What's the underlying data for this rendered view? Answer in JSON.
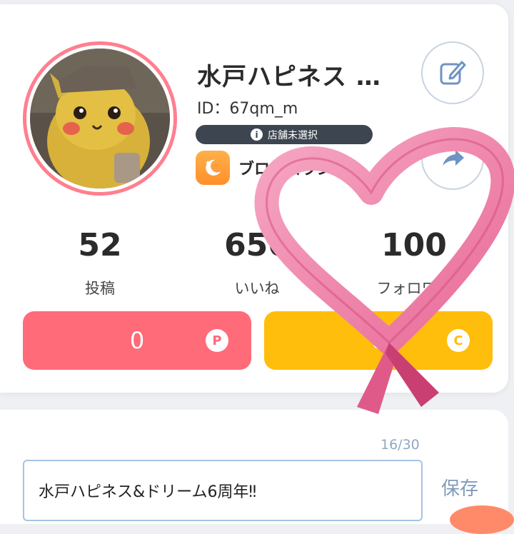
{
  "profile": {
    "username": "水戸ハピネス …",
    "user_id": "ID：67qm_m",
    "store_status": "店舗未選択",
    "rank_label": "ブロンズランク"
  },
  "stats": [
    {
      "value": "52",
      "label": "投稿"
    },
    {
      "value": "656",
      "label": "いいね"
    },
    {
      "value": "100",
      "label": "フォロワー"
    }
  ],
  "points": [
    {
      "value": "0",
      "badge": "P",
      "color": "#ff6b78"
    },
    {
      "value": "0",
      "badge": "C",
      "color": "#ffbe0b"
    }
  ],
  "bio": {
    "counter": "16/30",
    "value": "水戸ハピネス&ドリーム6周年‼︎",
    "save_label": "保存"
  },
  "icons": {
    "edit": "edit-icon",
    "share": "share-icon",
    "info": "info-icon",
    "rank": "moon-icon",
    "sticker": "heart-ribbon-sticker"
  }
}
